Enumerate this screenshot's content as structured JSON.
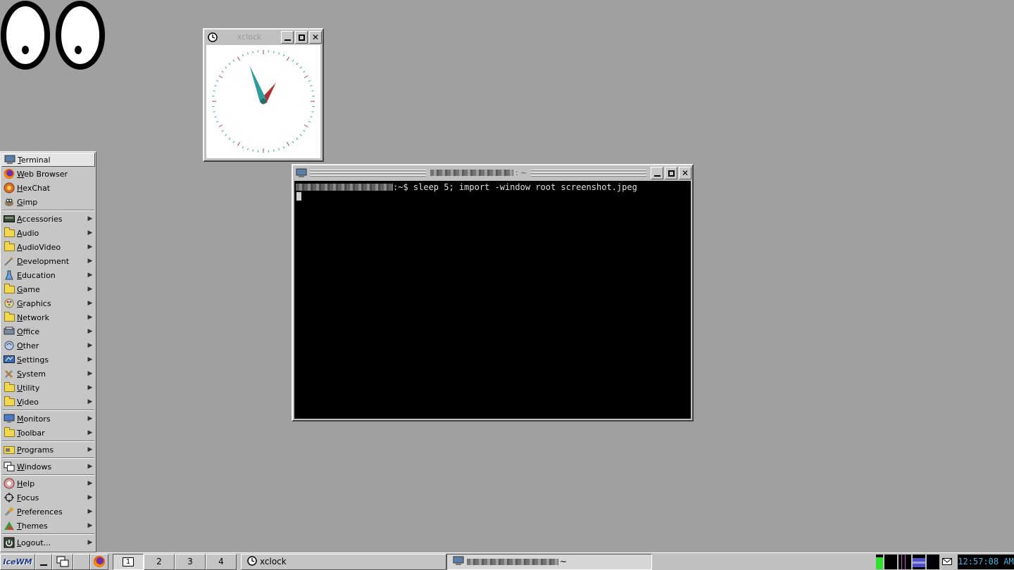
{
  "xclock": {
    "title": "xclock"
  },
  "terminal": {
    "title": "~",
    "prompt_suffix": ":~$ ",
    "command": "sleep 5; import -window root screenshot.jpeg"
  },
  "menu": {
    "items": [
      {
        "label": "Terminal",
        "icon": "terminal-icon",
        "submenu": false
      },
      {
        "label": "Web Browser",
        "icon": "firefox-icon",
        "submenu": false
      },
      {
        "label": "HexChat",
        "icon": "hexchat-icon",
        "submenu": false
      },
      {
        "label": "Gimp",
        "icon": "gimp-icon",
        "submenu": false
      },
      {
        "label": "Accessories",
        "icon": "accessories-icon",
        "submenu": true
      },
      {
        "label": "Audio",
        "icon": "folder-icon",
        "submenu": true
      },
      {
        "label": "AudioVideo",
        "icon": "folder-icon",
        "submenu": true
      },
      {
        "label": "Development",
        "icon": "development-icon",
        "submenu": true
      },
      {
        "label": "Education",
        "icon": "education-icon",
        "submenu": true
      },
      {
        "label": "Game",
        "icon": "folder-icon",
        "submenu": true
      },
      {
        "label": "Graphics",
        "icon": "graphics-icon",
        "submenu": true
      },
      {
        "label": "Network",
        "icon": "folder-icon",
        "submenu": true
      },
      {
        "label": "Office",
        "icon": "office-icon",
        "submenu": true
      },
      {
        "label": "Other",
        "icon": "other-icon",
        "submenu": true
      },
      {
        "label": "Settings",
        "icon": "settings-icon",
        "submenu": true
      },
      {
        "label": "System",
        "icon": "system-icon",
        "submenu": true
      },
      {
        "label": "Utility",
        "icon": "folder-icon",
        "submenu": true
      },
      {
        "label": "Video",
        "icon": "folder-icon",
        "submenu": true
      },
      {
        "label": "Monitors",
        "icon": "monitor-icon",
        "submenu": true
      },
      {
        "label": "Toolbar",
        "icon": "folder-icon",
        "submenu": true
      },
      {
        "label": "Programs",
        "icon": "programs-icon",
        "submenu": true
      },
      {
        "label": "Windows",
        "icon": "windows-icon",
        "submenu": true
      },
      {
        "label": "Help",
        "icon": "help-icon",
        "submenu": true
      },
      {
        "label": "Focus",
        "icon": "focus-icon",
        "submenu": true
      },
      {
        "label": "Preferences",
        "icon": "preferences-icon",
        "submenu": true
      },
      {
        "label": "Themes",
        "icon": "themes-icon",
        "submenu": true
      },
      {
        "label": "Logout...",
        "icon": "logout-icon",
        "submenu": true
      }
    ]
  },
  "taskbar": {
    "start_label": "IceWM",
    "workspaces": [
      "1",
      "2",
      "3",
      "4"
    ],
    "tasks": [
      {
        "label": "xclock",
        "icon": "clock-icon"
      },
      {
        "label": "~",
        "icon": "terminal-icon"
      }
    ],
    "clock": "12:57:08 AM"
  },
  "colors": {
    "desktop": "#a0a0a0",
    "clock_hand_teal": "#2f9c9c",
    "clock_hand_red": "#b03030",
    "taskbar_clock": "#3fb3e6"
  }
}
